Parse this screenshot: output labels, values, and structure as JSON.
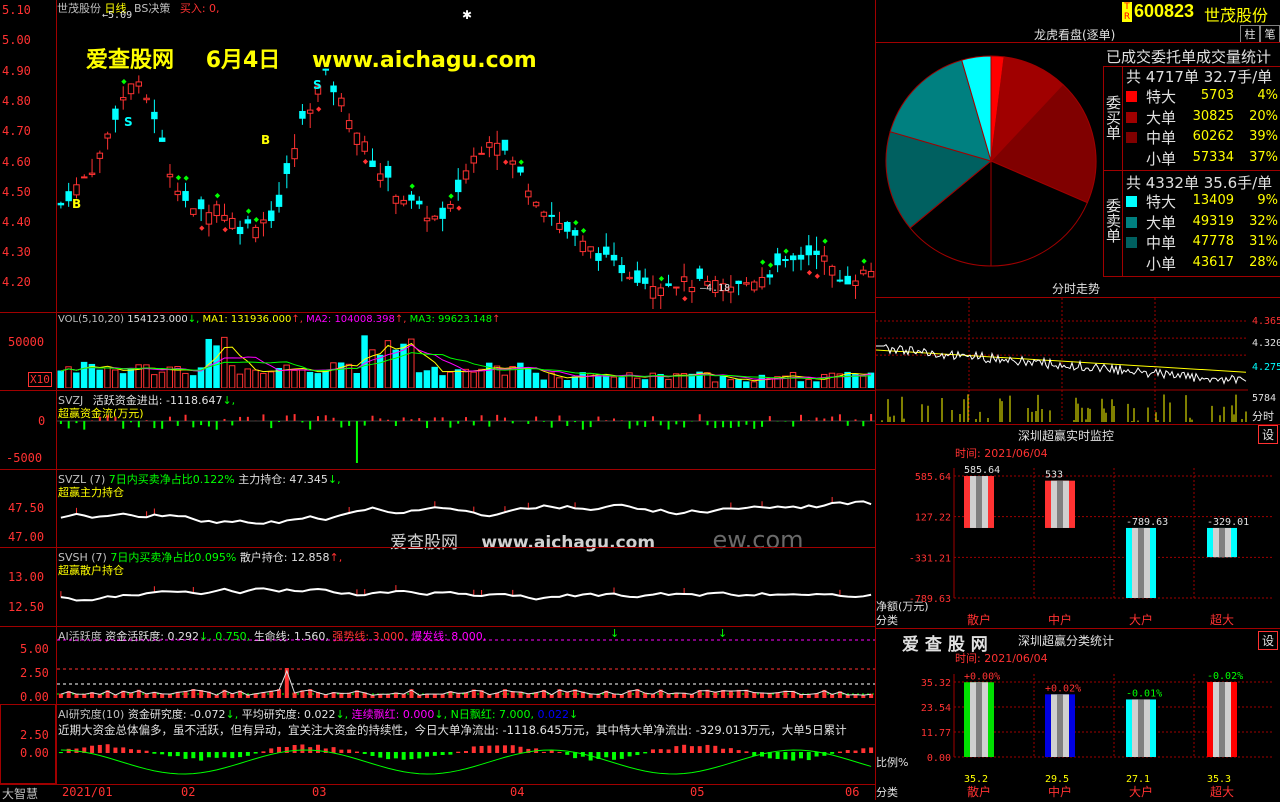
{
  "stock": {
    "code": "600823",
    "name": "世茂股份",
    "badge_top": "T",
    "badge_bottom": "R",
    "period": "日线",
    "strategy": "BS决策",
    "buy_label": "买入: 0,"
  },
  "watermark": {
    "site": "爱查股网",
    "date": "6月4日",
    "url": "www.aichagu.com",
    "url2": "www.aichagu.com",
    "site2": "爱查股网",
    "url_frag": "ew.com"
  },
  "price_axis": [
    "5.10",
    "5.00",
    "4.90",
    "4.80",
    "4.70",
    "4.60",
    "4.50",
    "4.40",
    "4.30",
    "4.20"
  ],
  "price_annot": {
    "high": "5.09",
    "low": "4.18"
  },
  "signals": {
    "b": "B",
    "s": "S"
  },
  "vol": {
    "header_prefix": "VOL(5,10,20)",
    "v": "154123.000",
    "ma1": "MA1: 131936.000",
    "ma2": "MA2: 104008.398",
    "ma3": "MA3: 99623.148",
    "arrow_down": "↓,",
    "arrow_up": "↑,",
    "arrow_up2": "↑",
    "axis": "50000",
    "unit": "X10"
  },
  "svzj": {
    "name": "SVZJ",
    "title": "活跃资金进出: -1118.647",
    "arrow": "↓,",
    "sub": "超赢资金流(万元)",
    "axis": [
      "0",
      "-5000"
    ]
  },
  "svzl": {
    "name": "SVZL",
    "param": "(7)",
    "desc": "7日内买卖净占比0.122%",
    "label": "主力持仓: 47.345",
    "arrow": "↓,",
    "sub": "超赢主力持仓",
    "axis": [
      "47.50",
      "47.00"
    ]
  },
  "svsh": {
    "name": "SVSH",
    "param": "(7)",
    "desc": "7日内买卖净占比0.095%",
    "label": "散户持仓: 12.858",
    "arrow": "↑,",
    "sub": "超赢散户持仓",
    "axis": [
      "13.00",
      "12.50"
    ]
  },
  "ai_active": {
    "title": "AI活跃度",
    "t1": "资金活跃度: 0.292",
    "t2": "↓, 0.750,",
    "t3": "生命线: 1.560,",
    "t4": "强势线: 3.000,",
    "t5": "爆发线: 8.000,",
    "axis": [
      "5.00",
      "2.50",
      "0.00"
    ],
    "arrow": "↓"
  },
  "ai_research": {
    "title": "AI研究度(10)",
    "t1": "资金研究度: -0.072",
    "t2": "↓,",
    "t3": "平均研究度: 0.022",
    "t4": "↓,",
    "t5": "连续飘红: 0.000",
    "t6": "↓,",
    "t7": "N日飘红: 7.000,",
    "t8": "0.022",
    "t9": "↓",
    "comment": "近期大资金总体偏多，虽不活跃，但有异动，宜关注大资金的持续性，今日大单净流出: -1118.645万元，其中特大单净流出: -329.013万元，大单5日累计",
    "axis": [
      "2.50",
      "0.00"
    ]
  },
  "time_axis": [
    "2021/01",
    "02",
    "03",
    "04",
    "05",
    "06"
  ],
  "brand": "大智慧",
  "top_right": {
    "btn1": "柱",
    "btn2": "笔"
  },
  "dragon": {
    "title": "龙虎看盘(逐单)",
    "subtitle": "已成交委托单成交量统计",
    "buy_side": "委买单",
    "sell_side": "委卖单",
    "buy_total": "共 4717单 32.7手/单",
    "sell_total": "共 4332单 35.6手/单",
    "buy_rows": [
      {
        "label": "特大",
        "value": "5703",
        "pct": "4%",
        "color": "#ff0000"
      },
      {
        "label": "大单",
        "value": "30825",
        "pct": "20%",
        "color": "#a00000"
      },
      {
        "label": "中单",
        "value": "60262",
        "pct": "39%",
        "color": "#800000"
      },
      {
        "label": "小单",
        "value": "57334",
        "pct": "37%",
        "color": "#000000"
      }
    ],
    "sell_rows": [
      {
        "label": "特大",
        "value": "13409",
        "pct": "9%",
        "color": "#00ffff"
      },
      {
        "label": "大单",
        "value": "49319",
        "pct": "32%",
        "color": "#008080"
      },
      {
        "label": "中单",
        "value": "47778",
        "pct": "31%",
        "color": "#006060"
      },
      {
        "label": "小单",
        "value": "43617",
        "pct": "28%",
        "color": "#000000"
      }
    ]
  },
  "intraday": {
    "title": "分时走势",
    "axis": [
      "4.365",
      "4.320",
      "4.275",
      "5784"
    ],
    "unit": "分时"
  },
  "monitor": {
    "title": "深圳超赢实时监控",
    "settings": "设",
    "time": "时间: 2021/06/04",
    "axis": [
      "585.64",
      "127.22",
      "-331.21",
      "-789.63"
    ],
    "ylabel": "净额(万元)",
    "xlabel": "分类",
    "bars": [
      {
        "cat": "散户",
        "value": 585.64,
        "label": "585.64"
      },
      {
        "cat": "中户",
        "value": 533,
        "label": "533"
      },
      {
        "cat": "大户",
        "value": -789.63,
        "label": "-789.63"
      },
      {
        "cat": "超大",
        "value": -329.01,
        "label": "-329.01"
      }
    ]
  },
  "classify": {
    "brand": "爱 查 股 网",
    "title": "深圳超赢分类统计",
    "settings": "设",
    "time": "时间: 2021/06/04",
    "axis": [
      "35.32",
      "23.54",
      "11.77",
      "0.00"
    ],
    "ylabel": "比例%",
    "xlabel": "分类",
    "bars": [
      {
        "cat": "散户",
        "value": 35.2,
        "label": "35.2",
        "delta": "+0.00%",
        "color": "#00e000"
      },
      {
        "cat": "中户",
        "value": 29.5,
        "label": "29.5",
        "delta": "+0.02%",
        "color": "#0000e0"
      },
      {
        "cat": "大户",
        "value": 27.1,
        "label": "27.1",
        "delta": "-0.01%",
        "color": "#00ffff"
      },
      {
        "cat": "超大",
        "value": 35.3,
        "label": "35.3",
        "delta": "-0.02%",
        "color": "#ff0000"
      }
    ]
  },
  "chart_data": {
    "type": "pie",
    "title": "龙虎看盘(逐单)",
    "slices": [
      {
        "name": "委买单 特大",
        "value": 4
      },
      {
        "name": "委买单 大单",
        "value": 20
      },
      {
        "name": "委买单 中单",
        "value": 39
      },
      {
        "name": "委买单 小单",
        "value": 37
      },
      {
        "name": "委卖单 特大",
        "value": 9
      },
      {
        "name": "委卖单 大单",
        "value": 32
      },
      {
        "name": "委卖单 中单",
        "value": 31
      },
      {
        "name": "委卖单 小单",
        "value": 28
      }
    ]
  }
}
